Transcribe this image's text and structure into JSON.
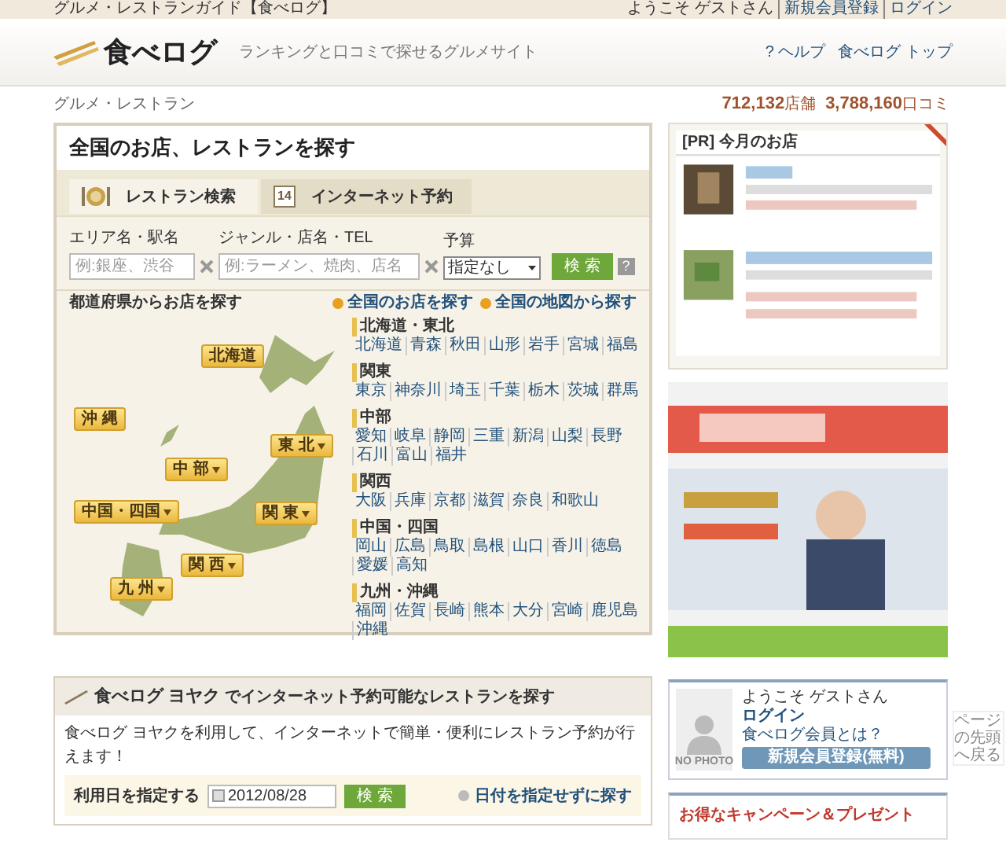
{
  "top_bar": {
    "site_title": "グルメ・レストランガイド【食べログ】",
    "greeting": "ようこそ ゲストさん",
    "links": [
      "新規会員登録",
      "ログイン"
    ]
  },
  "header": {
    "logo": "食べログ",
    "tagline": "ランキングと口コミで探せるグルメサイト",
    "nav": [
      "? ヘルプ",
      "食べログ トップ"
    ]
  },
  "breadcrumb": "グルメ・レストラン",
  "stats": [
    {
      "value": "712,132",
      "unit": "店舗"
    },
    {
      "value": "3,788,160",
      "unit": "口コミ"
    }
  ],
  "search_panel": {
    "title": "全国のお店、レストランを探す",
    "tabs": [
      {
        "label": "レストラン検索",
        "selected": true,
        "kind": "plate"
      },
      {
        "label": "インターネット予約",
        "selected": false,
        "kind": "calendar",
        "icon_text": "14"
      }
    ],
    "fields": [
      {
        "label": "エリア名・駅名",
        "placeholder": "例:銀座、渋谷"
      },
      {
        "label": "ジャンル・店名・TEL",
        "placeholder": "例:ラーメン、焼肉、店名"
      }
    ],
    "budget": {
      "label": "予算",
      "value": "指定なし"
    },
    "search_button": "検 索",
    "help": "?"
  },
  "prefectures": {
    "heading": "都道府県からお店を探す",
    "links": [
      "全国のお店を探す",
      "全国の地図から探す"
    ],
    "map_buttons": [
      {
        "label": "北海道",
        "has_menu": false
      },
      {
        "label": "沖 縄",
        "has_menu": false
      },
      {
        "label": "東 北",
        "has_menu": true
      },
      {
        "label": "中 部",
        "has_menu": true
      },
      {
        "label": "中国・四国",
        "has_menu": true
      },
      {
        "label": "関 東",
        "has_menu": true
      },
      {
        "label": "関 西",
        "has_menu": true
      },
      {
        "label": "九 州",
        "has_menu": true
      }
    ],
    "regions": [
      {
        "name": "北海道・東北",
        "prefectures": [
          "北海道",
          "青森",
          "秋田",
          "山形",
          "岩手",
          "宮城",
          "福島"
        ]
      },
      {
        "name": "関東",
        "prefectures": [
          "東京",
          "神奈川",
          "埼玉",
          "千葉",
          "栃木",
          "茨城",
          "群馬"
        ]
      },
      {
        "name": "中部",
        "prefectures": [
          "愛知",
          "岐阜",
          "静岡",
          "三重",
          "新潟",
          "山梨",
          "長野",
          "石川",
          "富山",
          "福井"
        ]
      },
      {
        "name": "関西",
        "prefectures": [
          "大阪",
          "兵庫",
          "京都",
          "滋賀",
          "奈良",
          "和歌山"
        ]
      },
      {
        "name": "中国・四国",
        "prefectures": [
          "岡山",
          "広島",
          "鳥取",
          "島根",
          "山口",
          "香川",
          "徳島",
          "愛媛",
          "高知"
        ]
      },
      {
        "name": "九州・沖縄",
        "prefectures": [
          "福岡",
          "佐賀",
          "長崎",
          "熊本",
          "大分",
          "宮崎",
          "鹿児島",
          "沖縄"
        ]
      }
    ]
  },
  "yoyaku": {
    "brand": "食べログ ヨヤク",
    "title": "でインターネット予約可能なレストランを探す",
    "description": "食べログ ヨヤクを利用して、インターネットで簡単・便利にレストラン予約が行えます！",
    "date_label": "利用日を指定する",
    "date_value": "2012/08/28",
    "search_button": "検 索",
    "link": "日付を指定せずに探す"
  },
  "sidebar": {
    "pr_title": "[PR] 今月のお店",
    "member": {
      "photo_label": "NO PHOTO",
      "greeting": "ようこそ ゲストさん",
      "login": "ログイン",
      "about": "食べログ会員とは？",
      "register": "新規会員登録(無料)"
    },
    "campaign_title": "お得なキャンペーン＆プレゼント"
  },
  "back_to_top": "ページの先頭へ戻る"
}
